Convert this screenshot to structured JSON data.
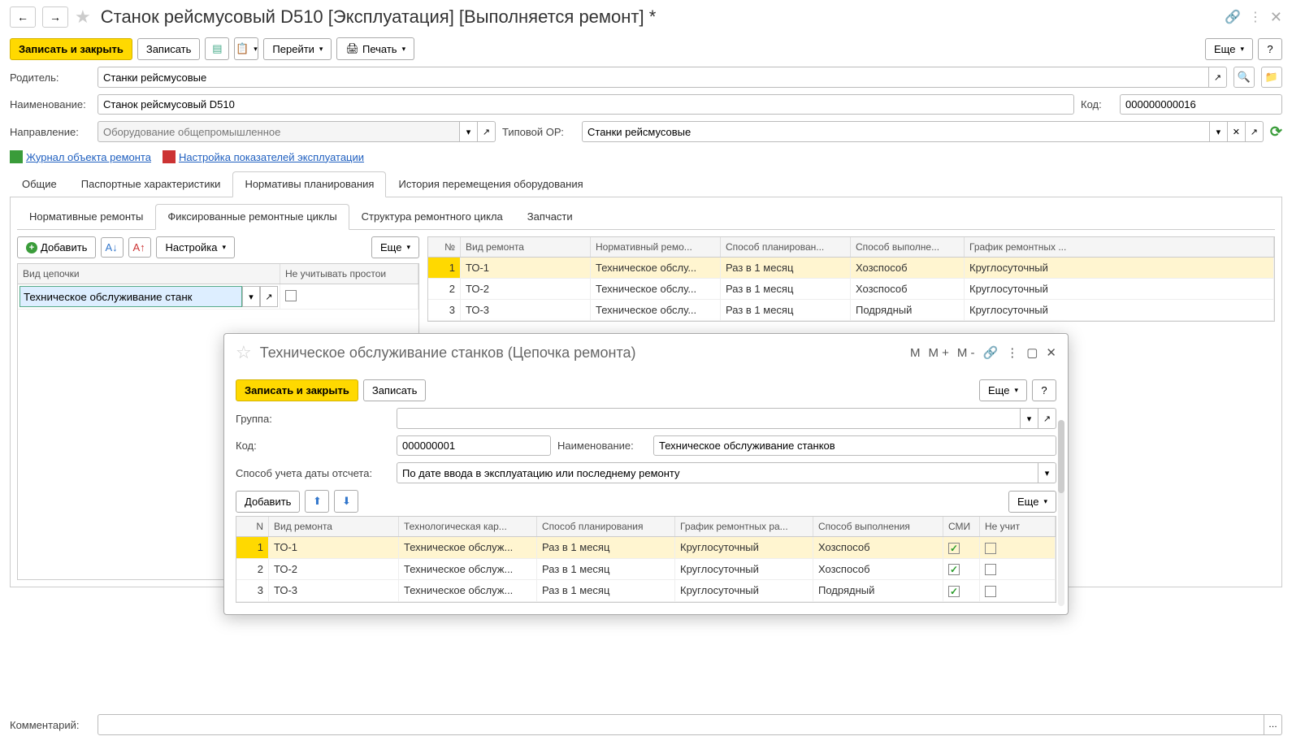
{
  "header": {
    "title": "Станок рейсмусовый D510 [Эксплуатация] [Выполняется ремонт] *"
  },
  "toolbar": {
    "save_close": "Записать и закрыть",
    "save": "Записать",
    "goto": "Перейти",
    "print": "Печать",
    "more": "Еще",
    "help": "?"
  },
  "form": {
    "parent_label": "Родитель:",
    "parent_value": "Станки рейсмусовые",
    "name_label": "Наименование:",
    "name_value": "Станок рейсмусовый D510",
    "code_label": "Код:",
    "code_value": "000000000016",
    "direction_label": "Направление:",
    "direction_value": "Оборудование общепромышленное",
    "typeor_label": "Типовой ОР:",
    "typeor_value": "Станки рейсмусовые"
  },
  "links": {
    "journal": "Журнал объекта ремонта",
    "settings": "Настройка показателей эксплуатации"
  },
  "tabs": [
    "Общие",
    "Паспортные характеристики",
    "Нормативы планирования",
    "История перемещения оборудования"
  ],
  "active_tab": 2,
  "subtabs": [
    "Нормативные ремонты",
    "Фиксированные ремонтные циклы",
    "Структура ремонтного цикла",
    "Запчасти"
  ],
  "active_subtab": 1,
  "subtoolbar": {
    "add": "Добавить",
    "setup": "Настройка",
    "more": "Еще"
  },
  "chain_table": {
    "col1": "Вид цепочки",
    "col2": "Не учитывать простои",
    "value": "Техническое обслуживание станк"
  },
  "repair_table": {
    "cols": [
      "№",
      "Вид ремонта",
      "Нормативный ремо...",
      "Способ планирован...",
      "Способ выполне...",
      "График ремонтных ..."
    ],
    "rows": [
      {
        "n": "1",
        "kind": "ТО-1",
        "norm": "Техническое обслу...",
        "plan": "Раз в 1 месяц",
        "exec": "Хозспособ",
        "sched": "Круглосуточный"
      },
      {
        "n": "2",
        "kind": "ТО-2",
        "norm": "Техническое обслу...",
        "plan": "Раз в 1 месяц",
        "exec": "Хозспособ",
        "sched": "Круглосуточный"
      },
      {
        "n": "3",
        "kind": "ТО-3",
        "norm": "Техническое обслу...",
        "plan": "Раз в 1 месяц",
        "exec": "Подрядный",
        "sched": "Круглосуточный"
      }
    ]
  },
  "modal": {
    "title": "Техническое обслуживание станков (Цепочка ремонта)",
    "m": "M",
    "mplus": "M +",
    "mminus": "M -",
    "save_close": "Записать и закрыть",
    "save": "Записать",
    "more": "Еще",
    "help": "?",
    "group_label": "Группа:",
    "group_value": "",
    "code_label": "Код:",
    "code_value": "000000001",
    "name_label": "Наименование:",
    "name_value": "Техническое обслуживание станков",
    "method_label": "Способ учета даты отсчета:",
    "method_value": "По дате ввода в эксплуатацию или последнему ремонту",
    "add": "Добавить",
    "table_cols": [
      "N",
      "Вид ремонта",
      "Технологическая кар...",
      "Способ планирования",
      "График ремонтных ра...",
      "Способ выполнения",
      "СМИ",
      "Не учит"
    ],
    "rows": [
      {
        "n": "1",
        "kind": "ТО-1",
        "tech": "Техническое обслуж...",
        "plan": "Раз в 1 месяц",
        "sched": "Круглосуточный",
        "exec": "Хозспособ",
        "smi": true,
        "skip": false
      },
      {
        "n": "2",
        "kind": "ТО-2",
        "tech": "Техническое обслуж...",
        "plan": "Раз в 1 месяц",
        "sched": "Круглосуточный",
        "exec": "Хозспособ",
        "smi": true,
        "skip": false
      },
      {
        "n": "3",
        "kind": "ТО-3",
        "tech": "Техническое обслуж...",
        "plan": "Раз в 1 месяц",
        "sched": "Круглосуточный",
        "exec": "Подрядный",
        "smi": true,
        "skip": false
      }
    ]
  },
  "comment": {
    "label": "Комментарий:",
    "value": ""
  }
}
